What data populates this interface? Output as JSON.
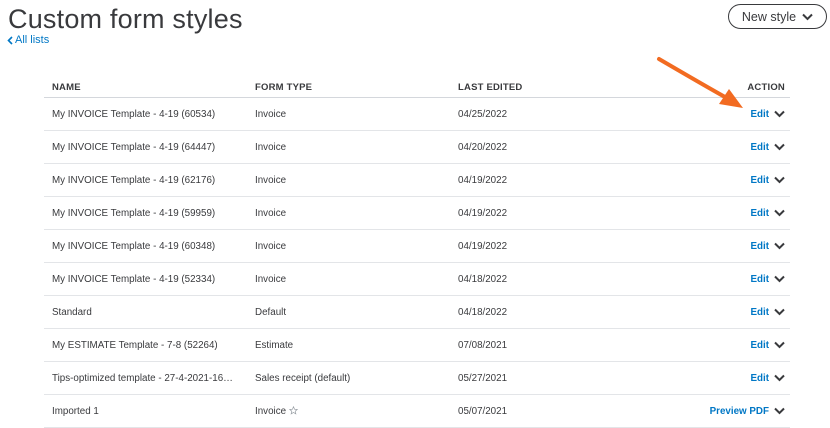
{
  "header": {
    "title": "Custom form styles",
    "back_label": "All lists",
    "new_style_label": "New style"
  },
  "table": {
    "columns": {
      "name": "NAME",
      "type": "FORM TYPE",
      "date": "LAST EDITED",
      "action": "ACTION"
    },
    "rows": [
      {
        "name": "My INVOICE Template - 4-19 (60534)",
        "type": "Invoice",
        "date": "04/25/2022",
        "action": "Edit"
      },
      {
        "name": "My INVOICE Template - 4-19 (64447)",
        "type": "Invoice",
        "date": "04/20/2022",
        "action": "Edit"
      },
      {
        "name": "My INVOICE Template - 4-19 (62176)",
        "type": "Invoice",
        "date": "04/19/2022",
        "action": "Edit"
      },
      {
        "name": "My INVOICE Template - 4-19 (59959)",
        "type": "Invoice",
        "date": "04/19/2022",
        "action": "Edit"
      },
      {
        "name": "My INVOICE Template - 4-19 (60348)",
        "type": "Invoice",
        "date": "04/19/2022",
        "action": "Edit"
      },
      {
        "name": "My INVOICE Template - 4-19 (52334)",
        "type": "Invoice",
        "date": "04/18/2022",
        "action": "Edit"
      },
      {
        "name": "Standard",
        "type": "Default",
        "date": "04/18/2022",
        "action": "Edit"
      },
      {
        "name": "My ESTIMATE Template - 7-8 (52264)",
        "type": "Estimate",
        "date": "07/08/2021",
        "action": "Edit"
      },
      {
        "name": "Tips-optimized template - 27-4-2021-16…",
        "type": "Sales receipt (default)",
        "date": "05/27/2021",
        "action": "Edit"
      },
      {
        "name": "Imported 1",
        "type": "Invoice",
        "date": "05/07/2021",
        "action": "Preview PDF"
      }
    ]
  },
  "colors": {
    "link": "#0077c5",
    "text": "#393a3d",
    "annotation_arrow": "#f26b21"
  },
  "icons": {
    "back": "chevron-left-icon",
    "dropdown": "chevron-down-icon",
    "star": "star-outline-icon",
    "annotation": "orange-arrow-icon"
  }
}
